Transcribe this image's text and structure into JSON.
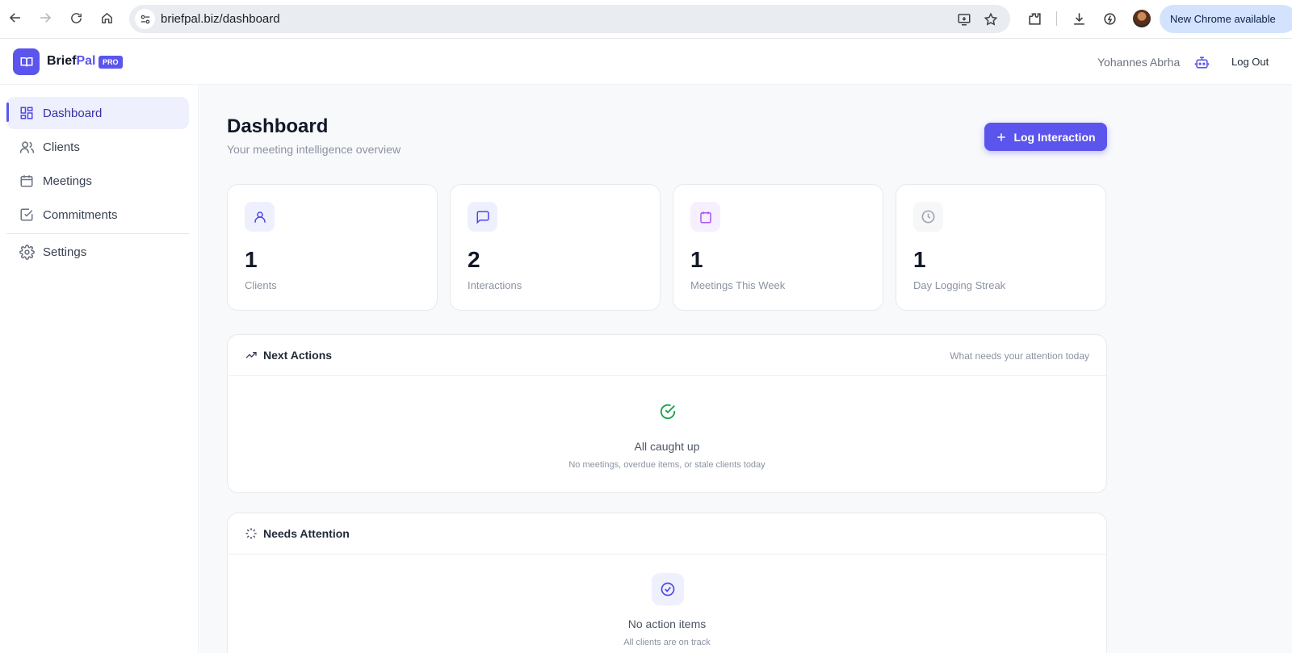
{
  "browser": {
    "url": "briefpal.biz/dashboard",
    "update_label": "New Chrome available"
  },
  "header": {
    "brand_part1": "Brief",
    "brand_part2": "Pal",
    "badge": "PRO",
    "user_name": "Yohannes Abrha",
    "logout_label": "Log Out"
  },
  "sidebar": {
    "items": [
      {
        "label": "Dashboard",
        "icon": "grid-icon",
        "active": true
      },
      {
        "label": "Clients",
        "icon": "users-icon"
      },
      {
        "label": "Meetings",
        "icon": "calendar-icon"
      },
      {
        "label": "Commitments",
        "icon": "check-square-icon"
      },
      {
        "label": "Settings",
        "icon": "gear-icon"
      }
    ]
  },
  "main": {
    "title": "Dashboard",
    "subtitle": "Your meeting intelligence overview",
    "log_button": "Log Interaction",
    "stats": [
      {
        "value": "1",
        "label": "Clients",
        "icon": "user-icon",
        "color": "#4f46e5",
        "bg": "#eef0fe"
      },
      {
        "value": "2",
        "label": "Interactions",
        "icon": "chat-icon",
        "color": "#4f46e5",
        "bg": "#eef0fe"
      },
      {
        "value": "1",
        "label": "Meetings This Week",
        "icon": "calendar-icon",
        "color": "#a855f7",
        "bg": "#f5effe"
      },
      {
        "value": "1",
        "label": "Day Logging Streak",
        "icon": "clock-icon",
        "color": "#9ca3af",
        "bg": "#f6f7f9"
      }
    ],
    "next_actions": {
      "title": "Next Actions",
      "subtitle": "What needs your attention today",
      "empty_title": "All caught up",
      "empty_sub": "No meetings, overdue items, or stale clients today"
    },
    "needs_attention": {
      "title": "Needs Attention",
      "empty_title": "No action items",
      "empty_sub": "All clients are on track"
    }
  },
  "colors": {
    "accent": "#5b55ee",
    "success": "#16a34a"
  }
}
